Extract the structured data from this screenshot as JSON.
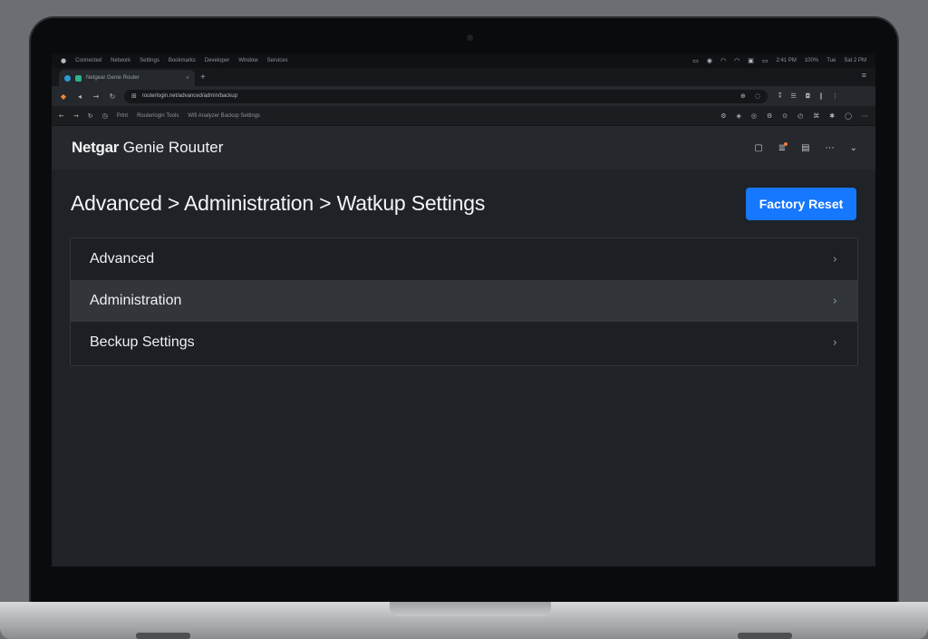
{
  "os_menubar": {
    "items": [
      "Connected",
      "Network",
      "Settings",
      "Bookmarks",
      "Developer",
      "Window",
      "Services"
    ],
    "status_icons": [
      "battery-icon",
      "sound-icon",
      "wifi-icon",
      "wifi-icon",
      "lock-icon",
      "battery-icon"
    ],
    "status_texts": [
      "2:41 PM",
      "100%",
      "Tue",
      "Sat 2 PM"
    ]
  },
  "browser": {
    "tab": {
      "title": "Netgear Genie Router"
    },
    "address": {
      "url": "routerlogin.net/advanced/admin/backup"
    },
    "bookmarks": [
      "Print",
      "Routerlogin Tools",
      "Wifi Analyzer Backup Settings"
    ]
  },
  "app": {
    "brand_bold": "Netgar",
    "brand_rest": " Genie Rouuter",
    "page_title": "Advanced > Administration > Watkup Settings",
    "factory_reset_label": "Factory Reset",
    "menu": [
      {
        "label": "Advanced"
      },
      {
        "label": "Administration",
        "active": true
      },
      {
        "label": "Beckup Settings"
      }
    ]
  },
  "colors": {
    "accent": "#1677ff",
    "background": "#1f2226",
    "header": "#25282c",
    "active_row": "#32363b"
  }
}
